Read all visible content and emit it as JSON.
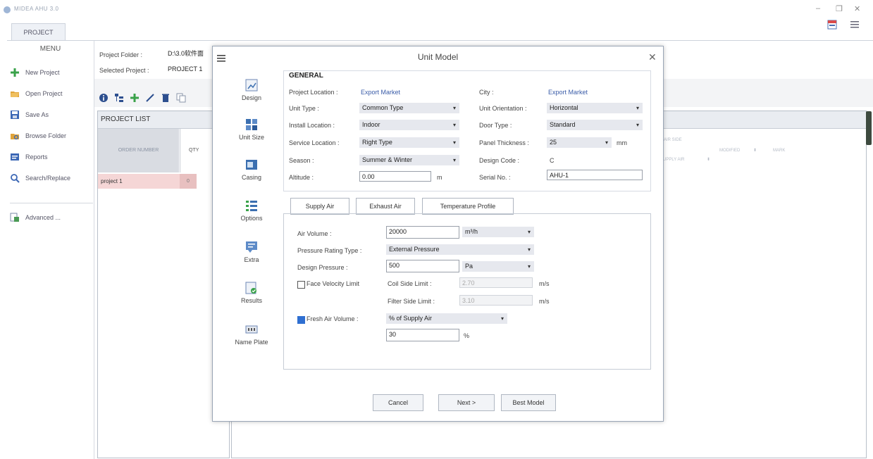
{
  "app": {
    "title": "MIDEA AHU 3.0",
    "tab": "PROJECT"
  },
  "menu": {
    "title": "MENU",
    "items": [
      {
        "label": "New Project",
        "icon": "plus-icon"
      },
      {
        "label": "Open Project",
        "icon": "folder-open-icon"
      },
      {
        "label": "Save As",
        "icon": "save-icon"
      },
      {
        "label": "Browse Folder",
        "icon": "browse-folder-icon"
      },
      {
        "label": "Reports",
        "icon": "report-icon"
      },
      {
        "label": "Search/Replace",
        "icon": "search-icon"
      },
      {
        "label": "Advanced ...",
        "icon": "advanced-icon"
      }
    ]
  },
  "project": {
    "folder_label": "Project Folder :",
    "folder_value": "D:\\3.0软件面",
    "selected_label": "Selected Project :",
    "selected_value": "PROJECT 1"
  },
  "project_list": {
    "title": "PROJECT LIST",
    "col_order": "ORDER NUMBER",
    "col_qty": "QTY",
    "rows": [
      {
        "order": "project 1",
        "qty": "0"
      }
    ]
  },
  "right_table": {
    "col_airside": "AIR SIDE",
    "col_supply": "SUPPLY AIR",
    "col_modified": "MODIFIED",
    "col_mark": "MARK"
  },
  "dialog": {
    "title": "Unit Model",
    "nav": [
      "Design",
      "Unit Size",
      "Casing",
      "Options",
      "Extra",
      "Results",
      "Name Plate"
    ],
    "general": {
      "title": "GENERAL",
      "project_location_label": "Project Location :",
      "project_location": "Export Market",
      "city_label": "City :",
      "city": "Export Market",
      "unit_type_label": "Unit Type :",
      "unit_type": "Common Type",
      "unit_orientation_label": "Unit Orientation :",
      "unit_orientation": "Horizontal",
      "install_location_label": "Install Location :",
      "install_location": "Indoor",
      "door_type_label": "Door Type :",
      "door_type": "Standard",
      "service_location_label": "Service Location :",
      "service_location": "Right Type",
      "panel_thickness_label": "Panel Thickness :",
      "panel_thickness": "25",
      "panel_unit": "mm",
      "season_label": "Season :",
      "season": "Summer & Winter",
      "design_code_label": "Design Code :",
      "design_code": "C",
      "altitude_label": "Altitude :",
      "altitude": "0.00",
      "altitude_unit": "m",
      "serial_label": "Serial No. :",
      "serial": "AHU-1"
    },
    "tabs": [
      "Supply Air",
      "Exhaust Air",
      "Temperature Profile"
    ],
    "supply": {
      "air_volume_label": "Air Volume :",
      "air_volume": "20000",
      "air_volume_unit": "m³/h",
      "pressure_rating_label": "Pressure Rating Type :",
      "pressure_rating": "External Pressure",
      "design_pressure_label": "Design Pressure :",
      "design_pressure": "500",
      "design_pressure_unit": "Pa",
      "face_velocity_label": "Face Velocity Limit",
      "face_velocity_checked": false,
      "coil_side_label": "Coil Side Limit :",
      "coil_side": "2.70",
      "coil_unit": "m/s",
      "filter_side_label": "Filter Side Limit :",
      "filter_side": "3.10",
      "filter_unit": "m/s",
      "fresh_air_label": "Fresh Air Volume :",
      "fresh_air_checked": true,
      "fresh_air_mode": "% of Supply Air",
      "fresh_air_value": "30",
      "fresh_air_unit": "%"
    },
    "buttons": {
      "cancel": "Cancel",
      "next": "Next >",
      "best": "Best Model"
    }
  }
}
